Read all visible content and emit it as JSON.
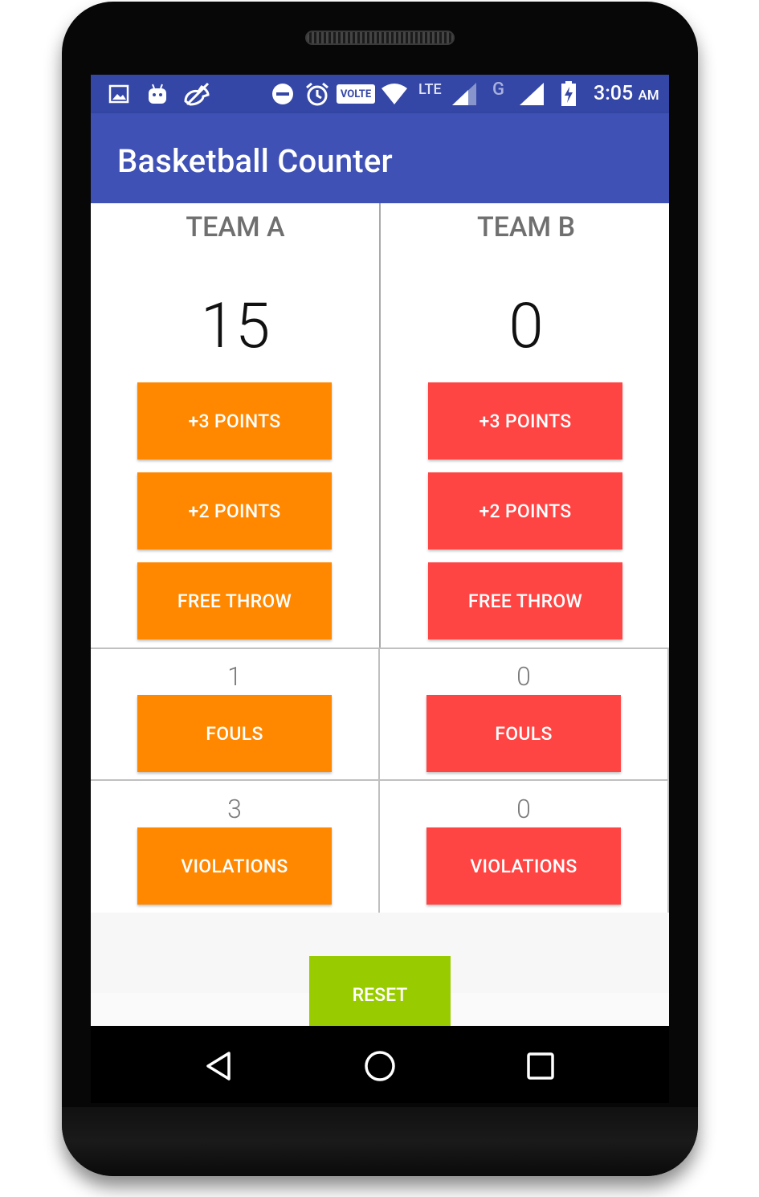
{
  "status_bar": {
    "time": "3:05",
    "ampm": "AM",
    "volte": "VOLTE",
    "lte": "LTE",
    "g": "G",
    "icons": [
      "gallery-icon",
      "android-icon",
      "call-missed-icon",
      "dnd-icon",
      "alarm-icon",
      "volte-icon",
      "wifi-icon",
      "lte-signal-icon",
      "g-signal-icon",
      "battery-charging-icon"
    ]
  },
  "app_bar": {
    "title": "Basketball Counter"
  },
  "team_a": {
    "name": "TEAM A",
    "score": "15",
    "plus3_label": "+3 POINTS",
    "plus2_label": "+2 POINTS",
    "free_throw_label": "FREE THROW",
    "fouls_count": "1",
    "fouls_label": "FOULS",
    "violations_count": "3",
    "violations_label": "VIOLATIONS",
    "color": "#ff8800"
  },
  "team_b": {
    "name": "TEAM B",
    "score": "0",
    "plus3_label": "+3 POINTS",
    "plus2_label": "+2 POINTS",
    "free_throw_label": "FREE THROW",
    "fouls_count": "0",
    "fouls_label": "FOULS",
    "violations_count": "0",
    "violations_label": "VIOLATIONS",
    "color": "#ff4444"
  },
  "reset_label": "RESET",
  "colors": {
    "primary": "#3f51b5",
    "primary_dark": "#3547a6",
    "reset": "#99cc00"
  },
  "nav": {
    "back": "back-icon",
    "home": "home-icon",
    "recents": "recents-icon"
  }
}
